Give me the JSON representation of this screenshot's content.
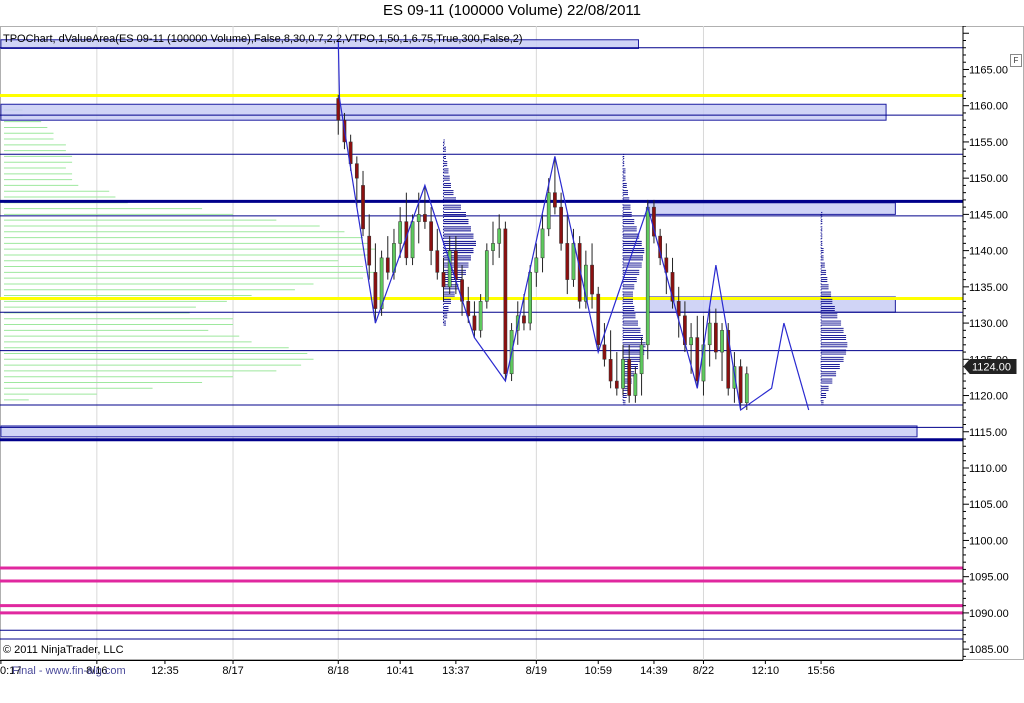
{
  "title": "ES 09-11 (100000 Volume)  22/08/2011",
  "indicator_label": "TPOChart, dValueArea(ES 09-11 (100000 Volume),False,8,30,0.7,2,2,VTPO,1,50,1,6.75,True,300,False,2)",
  "copyright": "© 2011 NinjaTrader, LLC",
  "watermark": "Final - www.fin-alg.com",
  "f_button": "F",
  "current_price_label": "1124.00",
  "colors": {
    "hline": "#00008b",
    "yellow": "#ffff00",
    "magenta": "#e0289f",
    "box_fill": "#c8ccf4",
    "box_stroke": "#1c1ca0",
    "profile": "#9ee89e",
    "tpo": "#00008b",
    "candle_up": "#5ec95e",
    "candle_down": "#8b1010",
    "zigzag": "#2a2ad0"
  },
  "chart_data": {
    "type": "candlestick",
    "title": "ES 09-11 (100000 Volume)  22/08/2011",
    "y_axis": {
      "range": [
        1083.5,
        1171
      ],
      "ticks": [
        "1165.00",
        "1160.00",
        "1155.00",
        "1150.00",
        "1145.00",
        "1140.00",
        "1135.00",
        "1130.00",
        "1125.00",
        "1120.00",
        "1115.00",
        "1110.00",
        "1105.00",
        "1100.00",
        "1095.00",
        "1090.00",
        "1085.00"
      ],
      "current_price": 1124.0
    },
    "x_axis": {
      "labels": [
        {
          "text": "0:17",
          "bar": -0.5
        },
        {
          "text": "8/16",
          "bar": 15
        },
        {
          "text": "12:35",
          "bar": 26
        },
        {
          "text": "8/17",
          "bar": 37
        },
        {
          "text": "8/18",
          "bar": 54
        },
        {
          "text": "10:41",
          "bar": 64
        },
        {
          "text": "13:37",
          "bar": 73
        },
        {
          "text": "8/19",
          "bar": 86
        },
        {
          "text": "10:59",
          "bar": 96
        },
        {
          "text": "14:39",
          "bar": 105
        },
        {
          "text": "8/22",
          "bar": 113
        },
        {
          "text": "12:10",
          "bar": 123
        },
        {
          "text": "15:56",
          "bar": 132
        }
      ],
      "grid_bars": [
        15,
        37,
        54,
        86,
        113
      ]
    },
    "horizontal_levels": [
      {
        "price": 1168.0,
        "color": "hline",
        "width": 1
      },
      {
        "price": 1161.4,
        "color": "yellow",
        "width": 3
      },
      {
        "price": 1158.7,
        "color": "hline",
        "width": 1
      },
      {
        "price": 1153.3,
        "color": "hline",
        "width": 1
      },
      {
        "price": 1146.8,
        "color": "hline",
        "width": 3
      },
      {
        "price": 1144.8,
        "color": "hline",
        "width": 1
      },
      {
        "price": 1133.4,
        "color": "yellow",
        "width": 3
      },
      {
        "price": 1131.5,
        "color": "hline",
        "width": 1
      },
      {
        "price": 1126.2,
        "color": "hline",
        "width": 1
      },
      {
        "price": 1118.7,
        "color": "hline",
        "width": 1
      },
      {
        "price": 1115.6,
        "color": "hline",
        "width": 1
      },
      {
        "price": 1113.9,
        "color": "hline",
        "width": 3
      },
      {
        "price": 1096.2,
        "color": "magenta",
        "width": 3
      },
      {
        "price": 1094.4,
        "color": "magenta",
        "width": 3
      },
      {
        "price": 1091.0,
        "color": "magenta",
        "width": 3
      },
      {
        "price": 1090.0,
        "color": "magenta",
        "width": 3
      },
      {
        "price": 1087.6,
        "color": "hline",
        "width": 1
      },
      {
        "price": 1086.4,
        "color": "hline",
        "width": 1
      }
    ],
    "value_area_boxes": [
      {
        "from_bar": -0.5,
        "to_bar": 102.5,
        "high": 1169.1,
        "low": 1167.9
      },
      {
        "from_bar": -0.5,
        "to_bar": 142.5,
        "high": 1160.2,
        "low": 1158.0
      },
      {
        "from_bar": 104,
        "to_bar": 144,
        "high": 1146.6,
        "low": 1145.0
      },
      {
        "from_bar": 104,
        "to_bar": 144,
        "high": 1133.6,
        "low": 1131.5
      },
      {
        "from_bar": -0.5,
        "to_bar": 147.5,
        "high": 1115.8,
        "low": 1114.3
      }
    ],
    "volume_profile": {
      "from_bar": 0,
      "rows": [
        [
          1159.4,
          3
        ],
        [
          1158.6,
          3
        ],
        [
          1157.8,
          6
        ],
        [
          1157.0,
          7
        ],
        [
          1156.2,
          8
        ],
        [
          1155.4,
          8
        ],
        [
          1154.6,
          10
        ],
        [
          1153.8,
          10
        ],
        [
          1153.0,
          11
        ],
        [
          1152.2,
          11
        ],
        [
          1151.4,
          10
        ],
        [
          1150.6,
          11
        ],
        [
          1149.8,
          11
        ],
        [
          1149.0,
          12
        ],
        [
          1148.2,
          17
        ],
        [
          1147.4,
          18
        ],
        [
          1146.6,
          20
        ],
        [
          1145.8,
          32
        ],
        [
          1145.0,
          37
        ],
        [
          1144.2,
          44
        ],
        [
          1143.4,
          51
        ],
        [
          1142.6,
          55
        ],
        [
          1141.8,
          58
        ],
        [
          1141.0,
          59
        ],
        [
          1140.2,
          60
        ],
        [
          1139.4,
          59
        ],
        [
          1138.6,
          54
        ],
        [
          1137.8,
          58
        ],
        [
          1137.0,
          60
        ],
        [
          1136.2,
          58
        ],
        [
          1135.4,
          50
        ],
        [
          1134.6,
          47
        ],
        [
          1133.8,
          40
        ],
        [
          1133.0,
          36
        ],
        [
          1132.2,
          31
        ],
        [
          1131.4,
          30
        ],
        [
          1130.6,
          37
        ],
        [
          1129.8,
          37
        ],
        [
          1129.0,
          33
        ],
        [
          1128.2,
          38
        ],
        [
          1127.4,
          40
        ],
        [
          1126.6,
          46
        ],
        [
          1125.8,
          49
        ],
        [
          1125.0,
          50
        ],
        [
          1124.2,
          48
        ],
        [
          1123.4,
          44
        ],
        [
          1122.6,
          37
        ],
        [
          1121.8,
          32
        ],
        [
          1121.0,
          24
        ],
        [
          1120.2,
          15
        ],
        [
          1119.4,
          4
        ]
      ]
    },
    "candles": [
      [
        54,
        1161,
        1161.5,
        1156,
        1158
      ],
      [
        55,
        1158,
        1159,
        1154,
        1155
      ],
      [
        56,
        1155,
        1156,
        1151,
        1152
      ],
      [
        57,
        1152,
        1153,
        1146,
        1150
      ],
      [
        58,
        1149,
        1151,
        1142,
        1143
      ],
      [
        59,
        1142,
        1145,
        1136,
        1138
      ],
      [
        60,
        1137,
        1141,
        1130,
        1132
      ],
      [
        61,
        1132,
        1140,
        1131,
        1139
      ],
      [
        62,
        1139,
        1142,
        1136,
        1137
      ],
      [
        63,
        1137,
        1143,
        1136,
        1141
      ],
      [
        64,
        1141,
        1146,
        1139,
        1144
      ],
      [
        65,
        1144,
        1148,
        1138,
        1139
      ],
      [
        66,
        1139,
        1145,
        1138,
        1144
      ],
      [
        67,
        1144,
        1148,
        1141,
        1145
      ],
      [
        68,
        1145,
        1149,
        1143,
        1144
      ],
      [
        69,
        1144,
        1146,
        1138,
        1140
      ],
      [
        70,
        1140,
        1143,
        1136,
        1137
      ],
      [
        71,
        1137,
        1139,
        1133,
        1135
      ],
      [
        72,
        1135,
        1142,
        1134,
        1140
      ],
      [
        73,
        1140,
        1142,
        1134,
        1136
      ],
      [
        74,
        1136,
        1138,
        1131,
        1133
      ],
      [
        75,
        1133,
        1135,
        1130,
        1131
      ],
      [
        76,
        1131,
        1133,
        1128,
        1129
      ],
      [
        77,
        1129,
        1134,
        1128,
        1133
      ],
      [
        78,
        1133,
        1141,
        1132,
        1140
      ],
      [
        79,
        1140,
        1144,
        1138,
        1141
      ],
      [
        80,
        1141,
        1145,
        1139,
        1143
      ],
      [
        81,
        1143,
        1144,
        1122,
        1123
      ],
      [
        82,
        1123,
        1130,
        1122,
        1129
      ],
      [
        83,
        1129,
        1133,
        1127,
        1131
      ],
      [
        84,
        1131,
        1134,
        1129,
        1130
      ],
      [
        85,
        1130,
        1138,
        1129,
        1137
      ],
      [
        86,
        1137,
        1141,
        1135,
        1139
      ],
      [
        87,
        1139,
        1145,
        1137,
        1143
      ],
      [
        88,
        1143,
        1150,
        1142,
        1148
      ],
      [
        89,
        1148,
        1153,
        1145,
        1146
      ],
      [
        90,
        1146,
        1148,
        1140,
        1141
      ],
      [
        91,
        1141,
        1145,
        1134,
        1136
      ],
      [
        92,
        1136,
        1143,
        1135,
        1141
      ],
      [
        93,
        1141,
        1142,
        1132,
        1133
      ],
      [
        94,
        1133,
        1140,
        1132,
        1138
      ],
      [
        95,
        1138,
        1141,
        1132,
        1134
      ],
      [
        96,
        1134,
        1135,
        1126,
        1127
      ],
      [
        97,
        1127,
        1130,
        1124,
        1125
      ],
      [
        98,
        1125,
        1129,
        1121,
        1122
      ],
      [
        99,
        1122,
        1126,
        1120,
        1121
      ],
      [
        100,
        1121,
        1127,
        1120,
        1125
      ],
      [
        101,
        1125,
        1127,
        1119,
        1120
      ],
      [
        102,
        1120,
        1124,
        1119,
        1123
      ],
      [
        103,
        1123,
        1128,
        1120,
        1127
      ],
      [
        104,
        1127,
        1147,
        1125,
        1146
      ],
      [
        105,
        1146,
        1147,
        1141,
        1142
      ],
      [
        106,
        1142,
        1143,
        1138,
        1139
      ],
      [
        107,
        1139,
        1141,
        1134,
        1137
      ],
      [
        108,
        1137,
        1139,
        1132,
        1133
      ],
      [
        109,
        1133,
        1135,
        1128,
        1131
      ],
      [
        110,
        1131,
        1133,
        1126,
        1127
      ],
      [
        111,
        1127,
        1130,
        1123,
        1128
      ],
      [
        112,
        1128,
        1131,
        1121,
        1122
      ],
      [
        113,
        1122,
        1131,
        1120,
        1127
      ],
      [
        114,
        1127,
        1132,
        1124,
        1130
      ],
      [
        115,
        1130,
        1132,
        1125,
        1126
      ],
      [
        116,
        1126,
        1130,
        1122,
        1129
      ],
      [
        117,
        1129,
        1130,
        1120,
        1121
      ],
      [
        118,
        1121,
        1126,
        1119,
        1124
      ],
      [
        119,
        1124,
        1125,
        1118,
        1119
      ],
      [
        120,
        1119,
        1124,
        1118,
        1123
      ]
    ],
    "tpo_columns": [
      {
        "bar": 71,
        "low": 1130,
        "high": 1155,
        "widths": [
          2,
          3,
          4,
          6,
          9,
          12,
          15,
          18,
          20,
          22,
          24,
          26,
          24,
          22,
          20,
          18,
          14,
          10,
          8,
          6,
          5,
          4,
          3,
          2,
          2,
          1
        ]
      },
      {
        "bar": 100,
        "low": 1119,
        "high": 1153,
        "widths": [
          2,
          3,
          5,
          7,
          9,
          12,
          15,
          17,
          18,
          16,
          14,
          12,
          10,
          9,
          8,
          8,
          9,
          11,
          13,
          15,
          16,
          17,
          15,
          13,
          11,
          9,
          7,
          6,
          5,
          4,
          3,
          2,
          2,
          1,
          1
        ]
      },
      {
        "bar": 132,
        "low": 1119,
        "high": 1145,
        "widths": [
          2,
          4,
          6,
          9,
          12,
          15,
          18,
          20,
          21,
          20,
          18,
          16,
          13,
          11,
          9,
          8,
          6,
          5,
          4,
          3,
          2,
          2,
          1,
          1,
          1,
          1,
          1
        ]
      }
    ],
    "zigzag": [
      [
        54,
        1169
      ],
      [
        54.2,
        1161
      ],
      [
        60,
        1130
      ],
      [
        68,
        1149
      ],
      [
        76,
        1128
      ],
      [
        81,
        1122
      ],
      [
        89,
        1153
      ],
      [
        96,
        1126
      ],
      [
        104,
        1146
      ],
      [
        112,
        1121
      ],
      [
        115,
        1138
      ],
      [
        119,
        1118
      ],
      [
        124,
        1121
      ],
      [
        126,
        1130
      ],
      [
        130,
        1118
      ]
    ]
  }
}
